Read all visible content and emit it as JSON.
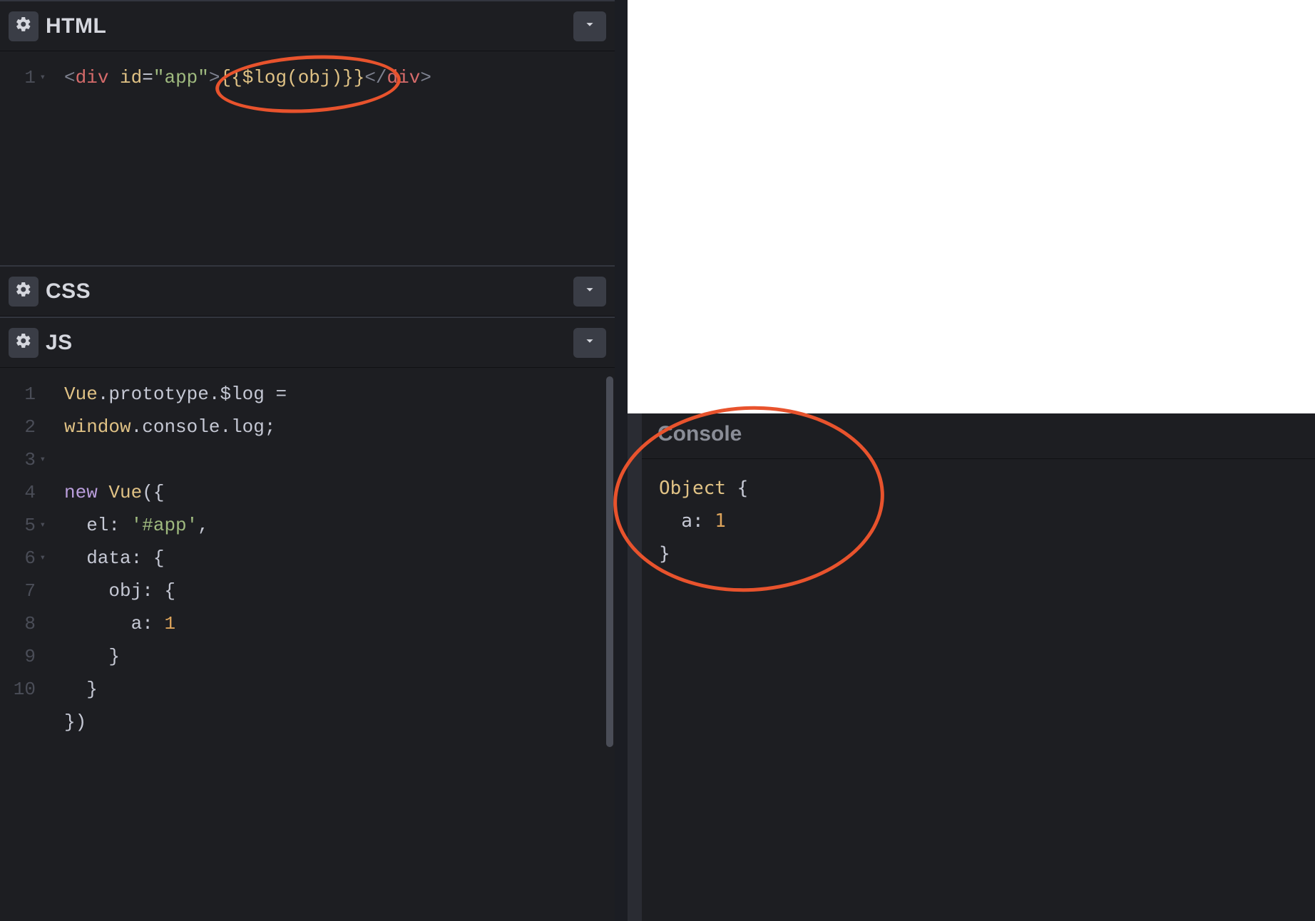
{
  "panels": {
    "html": {
      "title": "HTML"
    },
    "css": {
      "title": "CSS"
    },
    "js": {
      "title": "JS"
    }
  },
  "html_editor": {
    "line_numbers": [
      "1"
    ],
    "tokens": {
      "open_br": "<",
      "tag": "div",
      "attr": "id",
      "eq": "=",
      "val": "\"app\"",
      "close_br": ">",
      "template": "{{$log(obj)}}",
      "end_open": "</",
      "end_close": ">"
    }
  },
  "js_editor": {
    "line_numbers": [
      "1",
      "2",
      "3",
      "4",
      "5",
      "6",
      "7",
      "8",
      "9",
      "10"
    ],
    "l1": {
      "a": "Vue",
      "b": ".",
      "c": "prototype",
      "d": ".",
      "e": "$log",
      "f": " = "
    },
    "l1b": {
      "a": "window",
      "b": ".",
      "c": "console",
      "d": ".",
      "e": "log",
      "f": ";"
    },
    "l3": {
      "a": "new",
      "b": " Vue",
      "c": "({"
    },
    "l4": {
      "a": "  el",
      "b": ": ",
      "c": "'#app'",
      "d": ","
    },
    "l5": {
      "a": "  data",
      "b": ": {"
    },
    "l6": {
      "a": "    obj",
      "b": ": {"
    },
    "l7": {
      "a": "      a",
      "b": ": ",
      "c": "1"
    },
    "l8": "    }",
    "l9": "  }",
    "l10": "})"
  },
  "console": {
    "title": "Console",
    "out": {
      "l1a": "Object",
      "l1b": " {",
      "l2a": "  a",
      "l2b": ": ",
      "l2c": "1",
      "l3": "}"
    }
  }
}
